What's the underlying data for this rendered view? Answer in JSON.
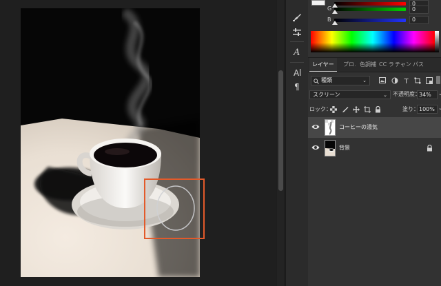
{
  "color_panel": {
    "channels": [
      {
        "label": "",
        "value": "0",
        "fill": 0.0,
        "color": "#ff3b3b"
      },
      {
        "label": "G",
        "value": "0",
        "fill": 0.0,
        "color": "#00c000"
      },
      {
        "label": "B",
        "value": "0",
        "fill": 0.0,
        "color": "#1f33ff"
      }
    ]
  },
  "layers_panel": {
    "tabs": [
      {
        "label": "レイヤー",
        "active": true
      },
      {
        "label": "プロノ",
        "active": false
      },
      {
        "label": "色調補",
        "active": false
      },
      {
        "label": "CC ラ",
        "active": false
      },
      {
        "label": "チャン",
        "active": false
      },
      {
        "label": "パス",
        "active": false
      }
    ],
    "filter": {
      "value": "種類"
    },
    "blend_mode": {
      "value": "スクリーン"
    },
    "opacity": {
      "label": "不透明度：",
      "value": "34%"
    },
    "lock": {
      "label": "ロック："
    },
    "fill": {
      "label": "塗り：",
      "value": "100%"
    },
    "layers": [
      {
        "name": "コーヒーの湯気",
        "visible": true,
        "selected": true,
        "locked": false
      },
      {
        "name": "背景",
        "visible": true,
        "selected": false,
        "locked": true
      }
    ]
  },
  "colors": {
    "accent_selection": "#e35a2a",
    "panel_bg": "#323232",
    "selected_layer_bg": "#474747"
  },
  "tools": [
    "brush-settings-icon",
    "adjust-sliders-icon",
    "character-panel-icon",
    "paragraph-panel-icon"
  ]
}
